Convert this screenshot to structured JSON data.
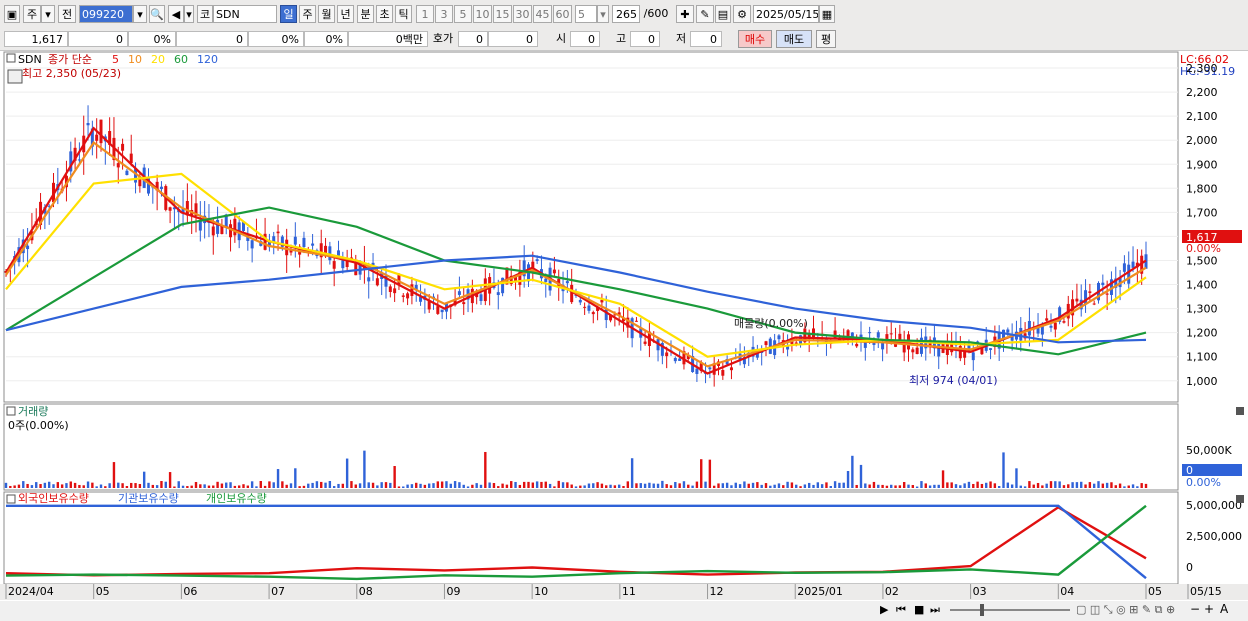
{
  "toolbar": {
    "period_label": "주",
    "prev_label": "전",
    "code": "099220",
    "stock_prefix": "코",
    "stock_name": "SDN",
    "tabs": [
      "일",
      "주",
      "월",
      "년",
      "분",
      "초",
      "틱"
    ],
    "selected_tab": "일",
    "intervals": [
      "1",
      "3",
      "5",
      "10",
      "15",
      "30",
      "45",
      "60"
    ],
    "interval_value": "5",
    "count": "265",
    "count_total": "/600",
    "date": "2025/05/15"
  },
  "inforow": {
    "price": "1,617",
    "change": "0",
    "change_pct": "0%",
    "volume": "0",
    "vol_pct": "0%",
    "pct2": "0%",
    "amount": "0백만",
    "quote_label": "호가",
    "quote1": "0",
    "quote2": "0",
    "open_label": "시",
    "open": "0",
    "high_label": "고",
    "high": "0",
    "low_label": "저",
    "low": "0",
    "buy_label": "매수",
    "sell_label": "매도",
    "avg_label": "평"
  },
  "price_panel": {
    "symbol": "SDN",
    "ma_title": "종가 단순",
    "ma_periods": [
      "5",
      "10",
      "20",
      "60",
      "120"
    ],
    "ma_colors": [
      "#e01010",
      "#f08c1e",
      "#ffe000",
      "#1a9a3a",
      "#2f62d8"
    ],
    "high_annot": "최고 2,350 (05/23)",
    "low_annot": "최저 974 (04/01)",
    "mid_annot": "매물량(0.00%)",
    "lc_label": "LC:66.02",
    "hc_label": "HC:-31.19",
    "last_price_tag": "1,617",
    "last_pct_tag": "0.00%",
    "y_ticks": [
      "1,000",
      "1,100",
      "1,200",
      "1,300",
      "1,400",
      "1,500",
      "1,600",
      "1,700",
      "1,800",
      "1,900",
      "2,000",
      "2,100",
      "2,200",
      "2,300"
    ]
  },
  "volume_panel": {
    "title": "거래량",
    "info": "0주(0.00%)",
    "y_ticks": [
      "50,000K"
    ],
    "last_tag": "0",
    "last_pct": "0.00%"
  },
  "holder_panel": {
    "legend": [
      "외국인보유수량",
      "기관보유수량",
      "개인보유수량"
    ],
    "legend_colors": [
      "#e01010",
      "#2f62d8",
      "#1a9a3a"
    ],
    "y_ticks": [
      "5,000,000",
      "2,500,000",
      "0"
    ]
  },
  "x_axis": {
    "labels": [
      "2024/04",
      "05",
      "06",
      "07",
      "08",
      "09",
      "10",
      "11",
      "12",
      "2025/01",
      "02",
      "03",
      "04",
      "05",
      "05/15"
    ]
  },
  "chart_data": {
    "type": "line",
    "title": "SDN",
    "x": [
      "2024/04",
      "2024/05",
      "2024/06",
      "2024/07",
      "2024/08",
      "2024/09",
      "2024/10",
      "2024/11",
      "2024/12",
      "2025/01",
      "2025/02",
      "2025/03",
      "2025/04",
      "2025/05"
    ],
    "ylim": [
      920,
      2350
    ],
    "series": [
      {
        "name": "5",
        "values": [
          1450,
          2050,
          1700,
          1580,
          1490,
          1300,
          1470,
          1250,
          1030,
          1180,
          1170,
          1120,
          1260,
          1500
        ]
      },
      {
        "name": "10",
        "values": [
          1440,
          1990,
          1720,
          1560,
          1500,
          1320,
          1460,
          1270,
          1060,
          1170,
          1160,
          1130,
          1250,
          1470
        ]
      },
      {
        "name": "20",
        "values": [
          1380,
          1820,
          1860,
          1580,
          1500,
          1380,
          1420,
          1320,
          1100,
          1150,
          1170,
          1150,
          1170,
          1430
        ]
      },
      {
        "name": "60",
        "values": [
          1210,
          1430,
          1650,
          1720,
          1640,
          1500,
          1450,
          1380,
          1300,
          1200,
          1170,
          1160,
          1110,
          1200
        ]
      },
      {
        "name": "120",
        "values": [
          1210,
          1300,
          1390,
          1420,
          1460,
          1500,
          1520,
          1450,
          1370,
          1300,
          1250,
          1220,
          1160,
          1170
        ]
      }
    ],
    "volume_ylim": [
      0,
      70000
    ],
    "holders": {
      "ylim": [
        -300000,
        5200000
      ],
      "series": [
        {
          "name": "외국인보유수량",
          "values": [
            250000,
            100000,
            200000,
            250000,
            600000,
            450000,
            650000,
            350000,
            150000,
            300000,
            350000,
            750000,
            4900000,
            1300000
          ]
        },
        {
          "name": "기관보유수량",
          "values": [
            5000000,
            5000000,
            5000000,
            5000000,
            5000000,
            5000000,
            5000000,
            5000000,
            5000000,
            5000000,
            5000000,
            5000000,
            5000000,
            -100000
          ]
        },
        {
          "name": "개인보유수량",
          "values": [
            80000,
            150000,
            80000,
            0,
            -150000,
            100000,
            0,
            250000,
            400000,
            280000,
            320000,
            520000,
            150000,
            5000000
          ]
        }
      ]
    }
  }
}
